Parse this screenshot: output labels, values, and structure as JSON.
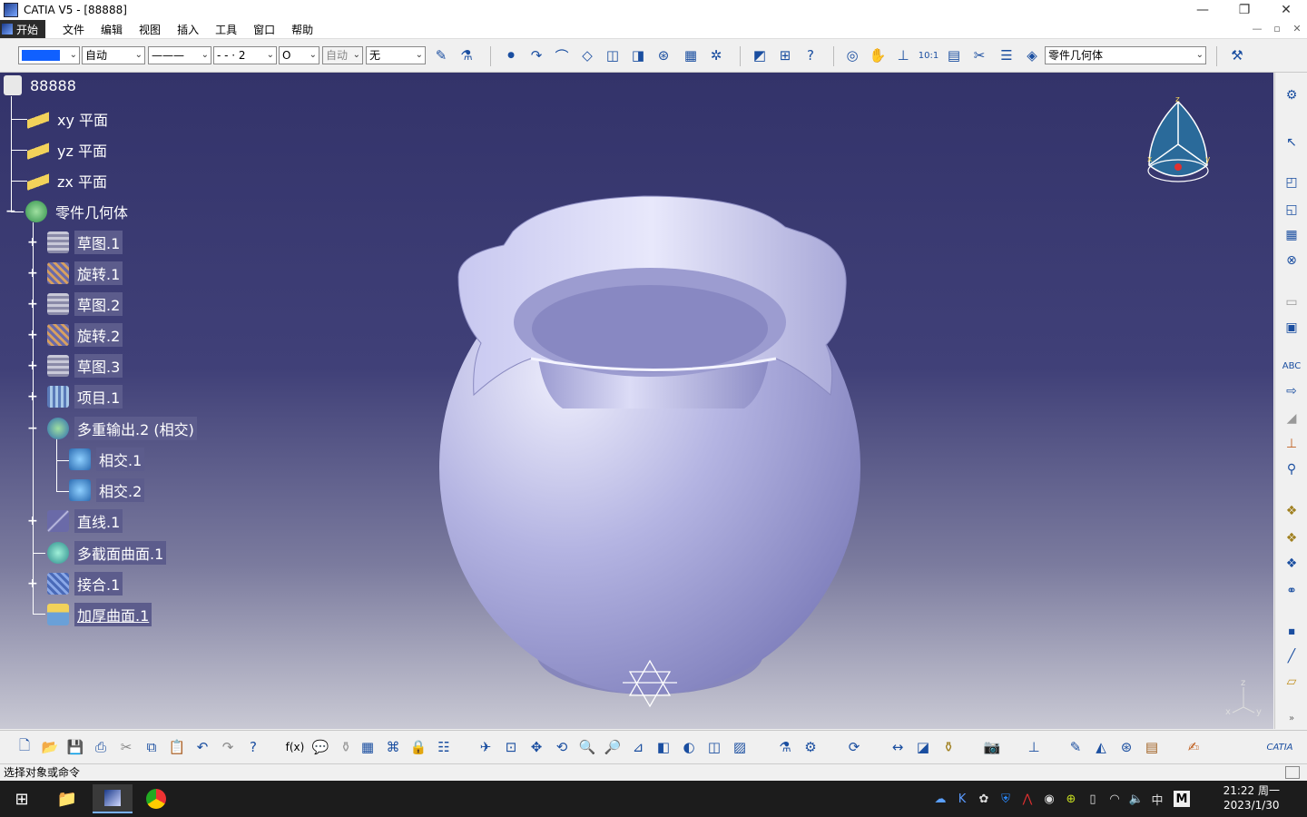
{
  "window": {
    "title": "CATIA V5 - [88888]",
    "min": "—",
    "restore": "❐",
    "close": "✕"
  },
  "menu": {
    "start": "开始",
    "items": [
      "文件",
      "编辑",
      "视图",
      "插入",
      "工具",
      "窗口",
      "帮助"
    ],
    "right": [
      "—",
      "▫",
      "✕"
    ]
  },
  "toolbar": {
    "color_sel": "",
    "thickness_sel": "自动",
    "linetype_sel": "———",
    "dash_sel": "- - · 2",
    "point_sel": "O",
    "layer_sel": "自动",
    "filter_sel": "无",
    "body_sel": "零件几何体"
  },
  "tree": {
    "root": "88888",
    "items": [
      {
        "label": "xy 平面",
        "icon": "plane-icon"
      },
      {
        "label": "yz 平面",
        "icon": "plane-icon"
      },
      {
        "label": "zx 平面",
        "icon": "plane-icon"
      },
      {
        "label": "零件几何体",
        "icon": "part-body-icon"
      },
      {
        "label": "草图.1",
        "icon": "sketch-icon"
      },
      {
        "label": "旋转.1",
        "icon": "revolve-icon"
      },
      {
        "label": "草图.2",
        "icon": "sketch-icon"
      },
      {
        "label": "旋转.2",
        "icon": "revolve-icon"
      },
      {
        "label": "草图.3",
        "icon": "sketch-icon"
      },
      {
        "label": "项目.1",
        "icon": "projection-icon"
      },
      {
        "label": "多重输出.2 (相交)",
        "icon": "multi-output-icon"
      },
      {
        "label": "相交.1",
        "icon": "intersect-icon"
      },
      {
        "label": "相交.2",
        "icon": "intersect-icon"
      },
      {
        "label": "直线.1",
        "icon": "line-icon"
      },
      {
        "label": "多截面曲面.1",
        "icon": "multi-section-surface-icon"
      },
      {
        "label": "接合.1",
        "icon": "join-icon"
      },
      {
        "label": "加厚曲面.1",
        "icon": "thick-surface-icon"
      }
    ]
  },
  "compass": {
    "x": "x",
    "y": "y",
    "z": "z"
  },
  "status_text": "选择对象或命令",
  "clock": {
    "time": "21:22 周一",
    "date": "2023/1/30"
  },
  "tray": {
    "ime": "中",
    "m": "M"
  },
  "colors": {
    "viewport_top": "#33336a",
    "viewport_bottom": "#c9c9d4",
    "vase": "#b8b8e0"
  }
}
